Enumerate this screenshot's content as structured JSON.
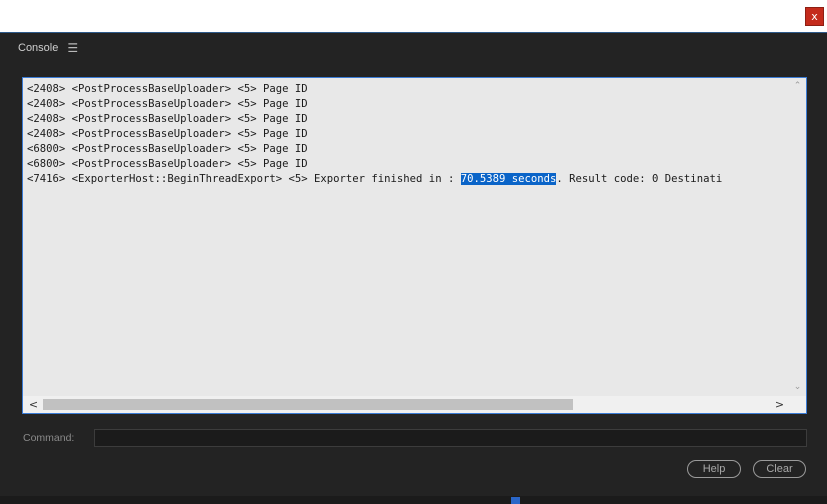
{
  "window": {
    "close_label": "x"
  },
  "panel": {
    "title": "Console",
    "menu_icon": "☰"
  },
  "console": {
    "lines": [
      {
        "pre": "<2408> <PostProcessBaseUploader> <5> Page ID",
        "sel": "",
        "post": ""
      },
      {
        "pre": "<2408> <PostProcessBaseUploader> <5> Page ID",
        "sel": "",
        "post": ""
      },
      {
        "pre": "<2408> <PostProcessBaseUploader> <5> Page ID",
        "sel": "",
        "post": ""
      },
      {
        "pre": "<2408> <PostProcessBaseUploader> <5> Page ID",
        "sel": "",
        "post": ""
      },
      {
        "pre": "<6800> <PostProcessBaseUploader> <5> Page ID",
        "sel": "",
        "post": ""
      },
      {
        "pre": "<6800> <PostProcessBaseUploader> <5> Page ID",
        "sel": "",
        "post": ""
      },
      {
        "pre": "<7416> <ExporterHost::BeginThreadExport> <5> Exporter finished in : ",
        "sel": "70.5389 seconds",
        "post": ". Result code: 0 Destinati"
      }
    ],
    "selection_color": "#0a64c8",
    "border_color": "#3a7bd5",
    "scroll_up_icon": "⌃",
    "scroll_down_icon": "⌄",
    "scroll_left_icon": "<",
    "scroll_right_icon": ">",
    "hscroll_position": 0.73
  },
  "command": {
    "label": "Command:",
    "value": "",
    "placeholder": ""
  },
  "buttons": {
    "help_label": "Help",
    "clear_label": "Clear"
  }
}
